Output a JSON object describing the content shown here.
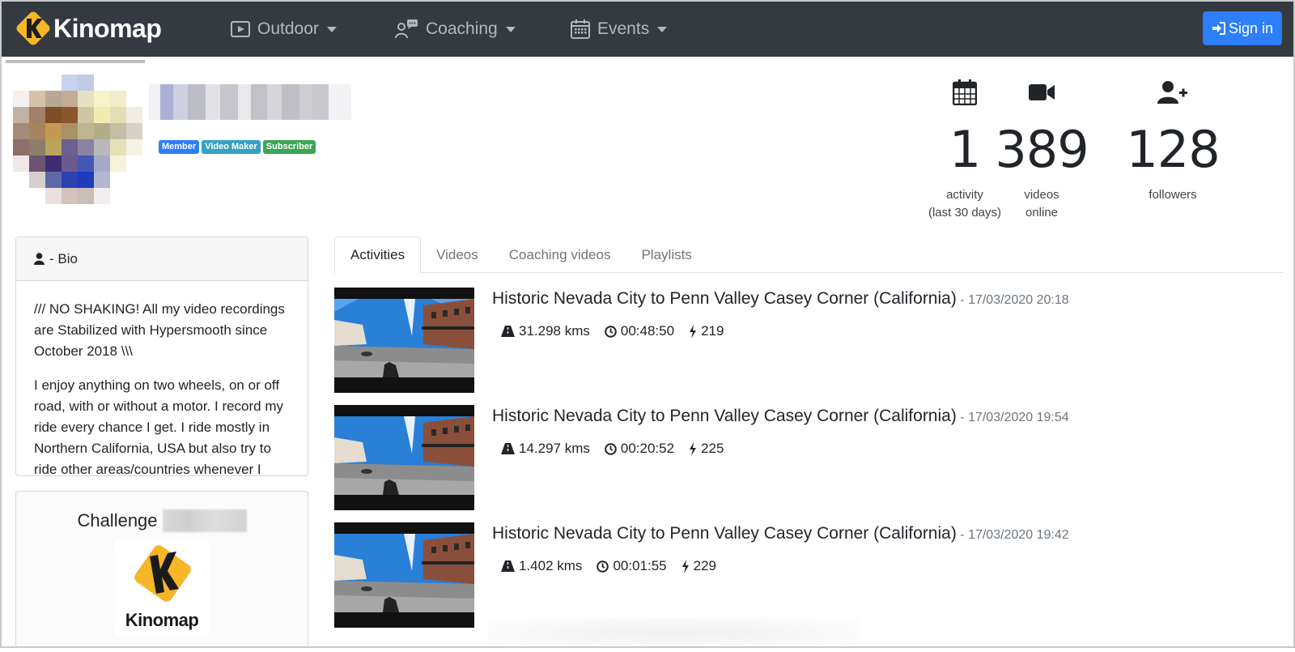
{
  "navbar": {
    "brand": "Kinomap",
    "items": [
      {
        "label": "Outdoor",
        "icon": "play-square-icon"
      },
      {
        "label": "Coaching",
        "icon": "coach-icon"
      },
      {
        "label": "Events",
        "icon": "calendar-icon"
      }
    ],
    "signin_label": "Sign in"
  },
  "profile": {
    "badges": [
      {
        "label": "Member",
        "color": "#2d7ff9"
      },
      {
        "label": "Video Maker",
        "color": "#36a2c4"
      },
      {
        "label": "Subscriber",
        "color": "#3aa655"
      }
    ],
    "stats": [
      {
        "value": "1",
        "label_line1": "activity",
        "label_line2": "(last 30 days)",
        "icon": "calendar-icon"
      },
      {
        "value": "389",
        "label_line1": "videos",
        "label_line2": "online",
        "icon": "video-camera-icon"
      },
      {
        "value": "128",
        "label_line1": "followers",
        "label_line2": "",
        "icon": "user-plus-icon"
      }
    ]
  },
  "bio": {
    "header": "- Bio",
    "paragraph1": "/// NO SHAKING! All my video recordings are Stabilized with Hypersmooth since October 2018 \\\\\\",
    "paragraph2": "I enjoy anything on two wheels, on or off road, with or without a motor. I record my ride every chance I get. I ride mostly in Northern California, USA but also try to ride other areas/countries whenever I"
  },
  "challenge": {
    "title": "Challenge",
    "logo_text": "Kinomap"
  },
  "tabs": [
    "Activities",
    "Videos",
    "Coaching videos",
    "Playlists"
  ],
  "activities": [
    {
      "title": "Historic Nevada City to Penn Valley Casey Corner (California)",
      "date": " - 17/03/2020 20:18",
      "distance": "31.298 kms",
      "duration": "00:48:50",
      "power": "219"
    },
    {
      "title": "Historic Nevada City to Penn Valley Casey Corner (California)",
      "date": " - 17/03/2020 19:54",
      "distance": "14.297 kms",
      "duration": "00:20:52",
      "power": "225"
    },
    {
      "title": "Historic Nevada City to Penn Valley Casey Corner (California)",
      "date": " - 17/03/2020 19:42",
      "distance": "1.402 kms",
      "duration": "00:01:55",
      "power": "229"
    }
  ]
}
